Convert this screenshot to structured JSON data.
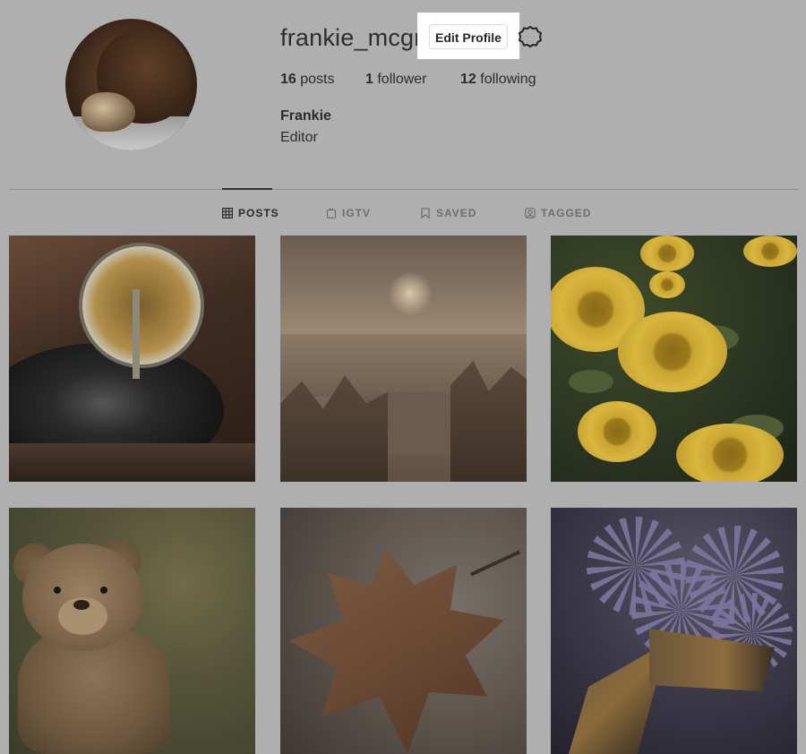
{
  "profile": {
    "username": "frankie_mcgr",
    "edit_button": "Edit Profile",
    "settings_icon": "gear-icon",
    "stats": {
      "posts_count": "16",
      "posts_label": "posts",
      "followers_count": "1",
      "followers_label": "follower",
      "following_count": "12",
      "following_label": "following"
    },
    "full_name": "Frankie",
    "bio": "Editor"
  },
  "tabs": [
    {
      "label": "POSTS",
      "icon": "grid-icon",
      "active": true
    },
    {
      "label": "IGTV",
      "icon": "igtv-icon",
      "active": false
    },
    {
      "label": "SAVED",
      "icon": "bookmark-icon",
      "active": false
    },
    {
      "label": "TAGGED",
      "icon": "tagged-icon",
      "active": false
    }
  ],
  "colors": {
    "overlay_background": "#afafaf",
    "highlight_background": "#ffffff"
  }
}
